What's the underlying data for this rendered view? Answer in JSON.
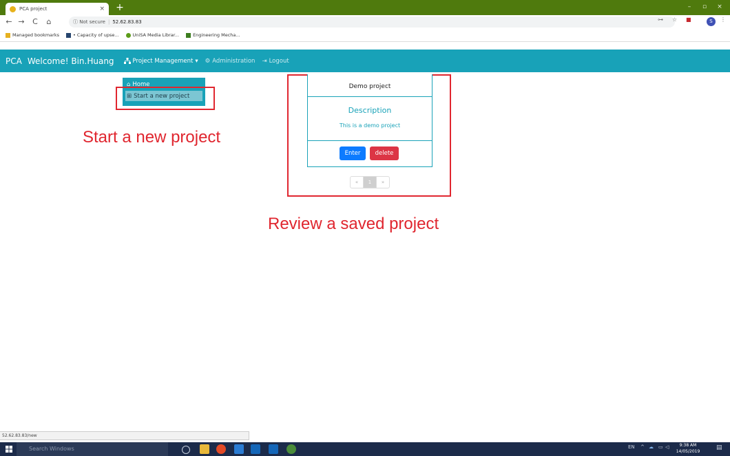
{
  "browser": {
    "tab_title": "PCA project",
    "tab_close": "×",
    "new_tab": "+",
    "win_minimize": "–",
    "win_restore": "▫",
    "win_close": "×",
    "nav_back": "←",
    "nav_forward": "→",
    "nav_reload": "C",
    "nav_home": "⌂",
    "security_label": "ⓘ Not secure",
    "url": "52.62.83.83",
    "key_icon_label": "⊶",
    "star_label": "☆",
    "ext_label": "■",
    "profile_initial": "S",
    "menu_label": "⋮",
    "bookmarks": [
      {
        "label": "Managed bookmarks",
        "color": "#e6b120"
      },
      {
        "label": "• Capacity of upse...",
        "color": "#26456e"
      },
      {
        "label": "UniSA Media Librar...",
        "color": "#5c9c1a"
      },
      {
        "label": "Engineering Mecha...",
        "color": "#3c7d1f"
      }
    ],
    "status_url": "52.62.83.83/new"
  },
  "app": {
    "brand": "PCA",
    "welcome": "Welcome! Bin.Huang",
    "nav": {
      "project_management": "Project Management",
      "administration": "Administration",
      "logout": "Logout"
    },
    "dropdown": {
      "home": "Home",
      "start_new": "Start a new project"
    },
    "card": {
      "name": "Demo project",
      "description_heading": "Description",
      "description": "This is a demo project",
      "enter": "Enter",
      "delete": "delete"
    },
    "pager": {
      "prev": "«",
      "current": "1",
      "next": "»"
    }
  },
  "annotations": {
    "start": "Start a new project",
    "review": "Review a saved project"
  },
  "taskbar": {
    "search": "Search Windows",
    "lang": "EN",
    "time": "9:38 AM",
    "date": "14/05/2019"
  },
  "colors": {
    "teal": "#18a2b8",
    "annotation_red": "#e0262f",
    "tab_green": "#4f7a0d"
  }
}
